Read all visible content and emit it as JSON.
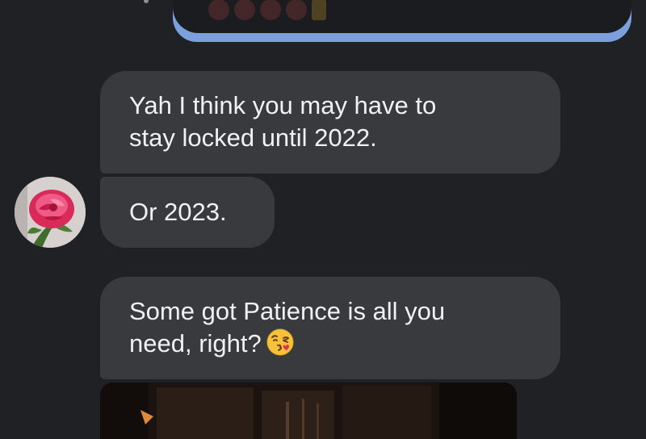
{
  "conversation": {
    "messages": [
      {
        "lines": [
          "Yah I think you may have to",
          "stay locked until 2022."
        ]
      },
      {
        "lines": [
          "Or 2023."
        ]
      },
      {
        "lines": [
          "Some got Patience is all you",
          "need, right?"
        ],
        "emoji": "face-blowing-kiss-icon"
      }
    ],
    "sender_avatar": "rose-avatar",
    "attachment": "image-attachment"
  },
  "colors": {
    "background": "#202124",
    "incoming_bubble": "#393a3e",
    "outgoing_accent": "#7ba0dd",
    "text": "#f1f1f3"
  }
}
